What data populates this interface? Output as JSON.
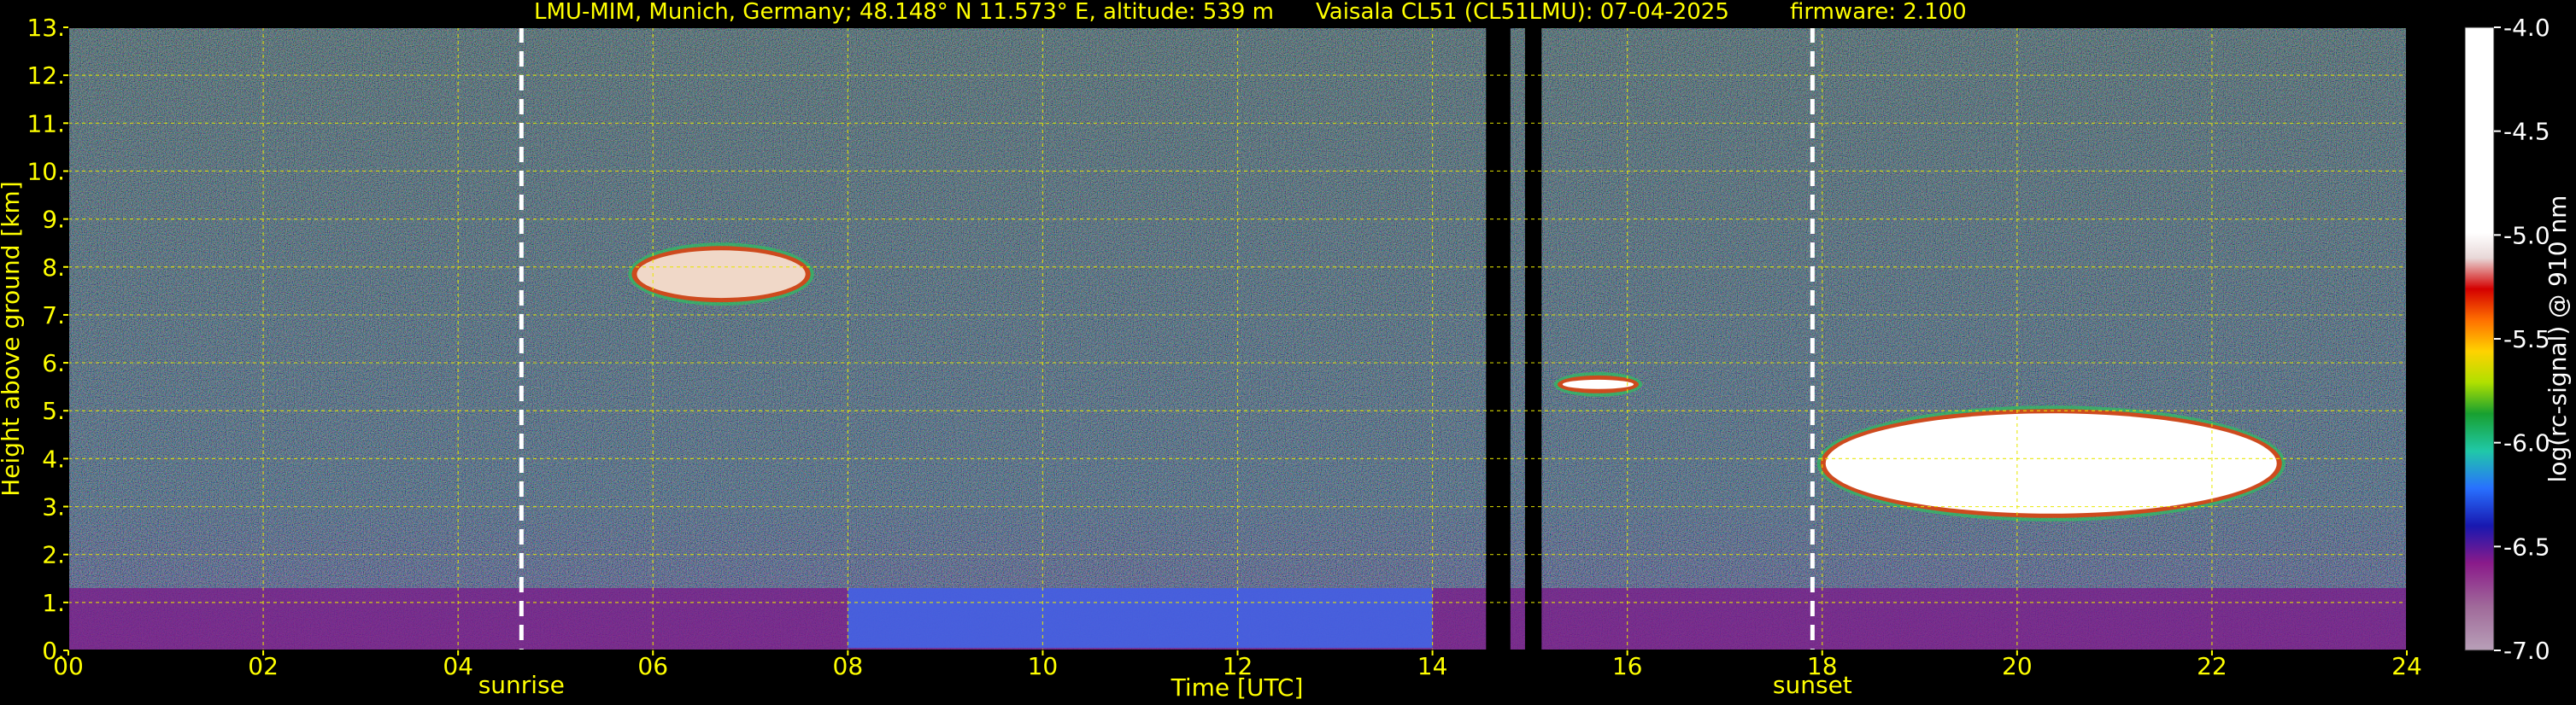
{
  "header": {
    "site": "LMU-MIM, Munich, Germany; 48.148° N 11.573° E, altitude: 539 m",
    "instrument": "Vaisala CL51 (CL51LMU): 07-04-2025",
    "firmware": "firmware: 2.100"
  },
  "chart_data": {
    "type": "heatmap",
    "title": "LMU-MIM, Munich, Germany; 48.148° N 11.573° E, altitude: 539 m    Vaisala CL51 (CL51LMU): 07-04-2025    firmware: 2.100",
    "xlabel": "Time [UTC]",
    "ylabel": "Height above ground [km]",
    "xlim": [
      0,
      24
    ],
    "ylim": [
      0,
      13
    ],
    "x_ticks": [
      "00",
      "02",
      "04",
      "06",
      "08",
      "10",
      "12",
      "14",
      "16",
      "18",
      "20",
      "22",
      "24"
    ],
    "y_ticks": [
      "0.",
      "1.",
      "2.",
      "3.",
      "4.",
      "5.",
      "6.",
      "7.",
      "8.",
      "9.",
      "10.",
      "11.",
      "12.",
      "13."
    ],
    "grid": true,
    "markers": [
      {
        "label": "sunrise",
        "time": 4.65
      },
      {
        "label": "sunset",
        "time": 17.9
      }
    ],
    "colorbar": {
      "label": "log(rc-signal) @ 910 nm",
      "range": [
        -7.0,
        -4.0
      ],
      "ticks": [
        "-4.0",
        "-4.5",
        "-5.0",
        "-5.5",
        "-6.0",
        "-6.5",
        "-7.0"
      ]
    },
    "features": [
      {
        "kind": "cloud",
        "t_start": 5.8,
        "t_end": 7.6,
        "h_low": 7.3,
        "h_high": 8.4
      },
      {
        "kind": "cloud",
        "t_start": 15.3,
        "t_end": 16.1,
        "h_low": 5.4,
        "h_high": 5.7
      },
      {
        "kind": "cloud",
        "t_start": 18.0,
        "t_end": 22.7,
        "h_low": 2.8,
        "h_high": 5.0
      },
      {
        "kind": "boundary_layer",
        "t_start": 0,
        "t_end": 24,
        "h_low": 0,
        "h_high": 1.3
      },
      {
        "kind": "data_gap",
        "t_start": 14.55,
        "t_end": 14.8
      },
      {
        "kind": "data_gap",
        "t_start": 14.95,
        "t_end": 15.12
      }
    ]
  }
}
